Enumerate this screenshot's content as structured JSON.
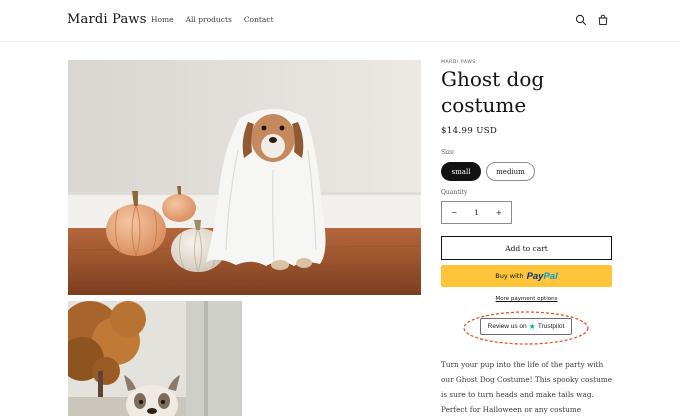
{
  "header": {
    "logo": "Mardi Paws",
    "nav": [
      {
        "label": "Home"
      },
      {
        "label": "All products"
      },
      {
        "label": "Contact"
      }
    ]
  },
  "product": {
    "vendor": "MARDI PAWS",
    "title": "Ghost dog costume",
    "price": "$14.99 USD",
    "size_label": "Size",
    "sizes": [
      {
        "label": "small",
        "selected": true
      },
      {
        "label": "medium",
        "selected": false
      }
    ],
    "quantity_label": "Quantity",
    "quantity": {
      "value": "1",
      "minus": "−",
      "plus": "+"
    },
    "add_to_cart": "Add to cart",
    "paypal": {
      "prefix": "Buy with",
      "brand_pay": "Pay",
      "brand_pal": "Pal"
    },
    "more_payment": "More payment options",
    "trustpilot": {
      "prefix": "Review us on",
      "brand": "Trustpilot",
      "star": "★"
    },
    "description": "Turn your pup into the life of the party with our Ghost Dog Costume! This spooky costume is sure to turn heads and make tails wag. Perfect for Halloween or any costume"
  },
  "images": {
    "main_icon": "dog-in-ghost-costume-with-pumpkins",
    "secondary_icon": "dog-outdoors-autumn-tree"
  },
  "colors": {
    "paypal_yellow": "#ffc439",
    "paypal_dark_blue": "#003087",
    "paypal_light_blue": "#009cde",
    "trustpilot_green": "#00b67a",
    "highlight_ring": "#d9501c",
    "selected_pill": "#121212"
  }
}
